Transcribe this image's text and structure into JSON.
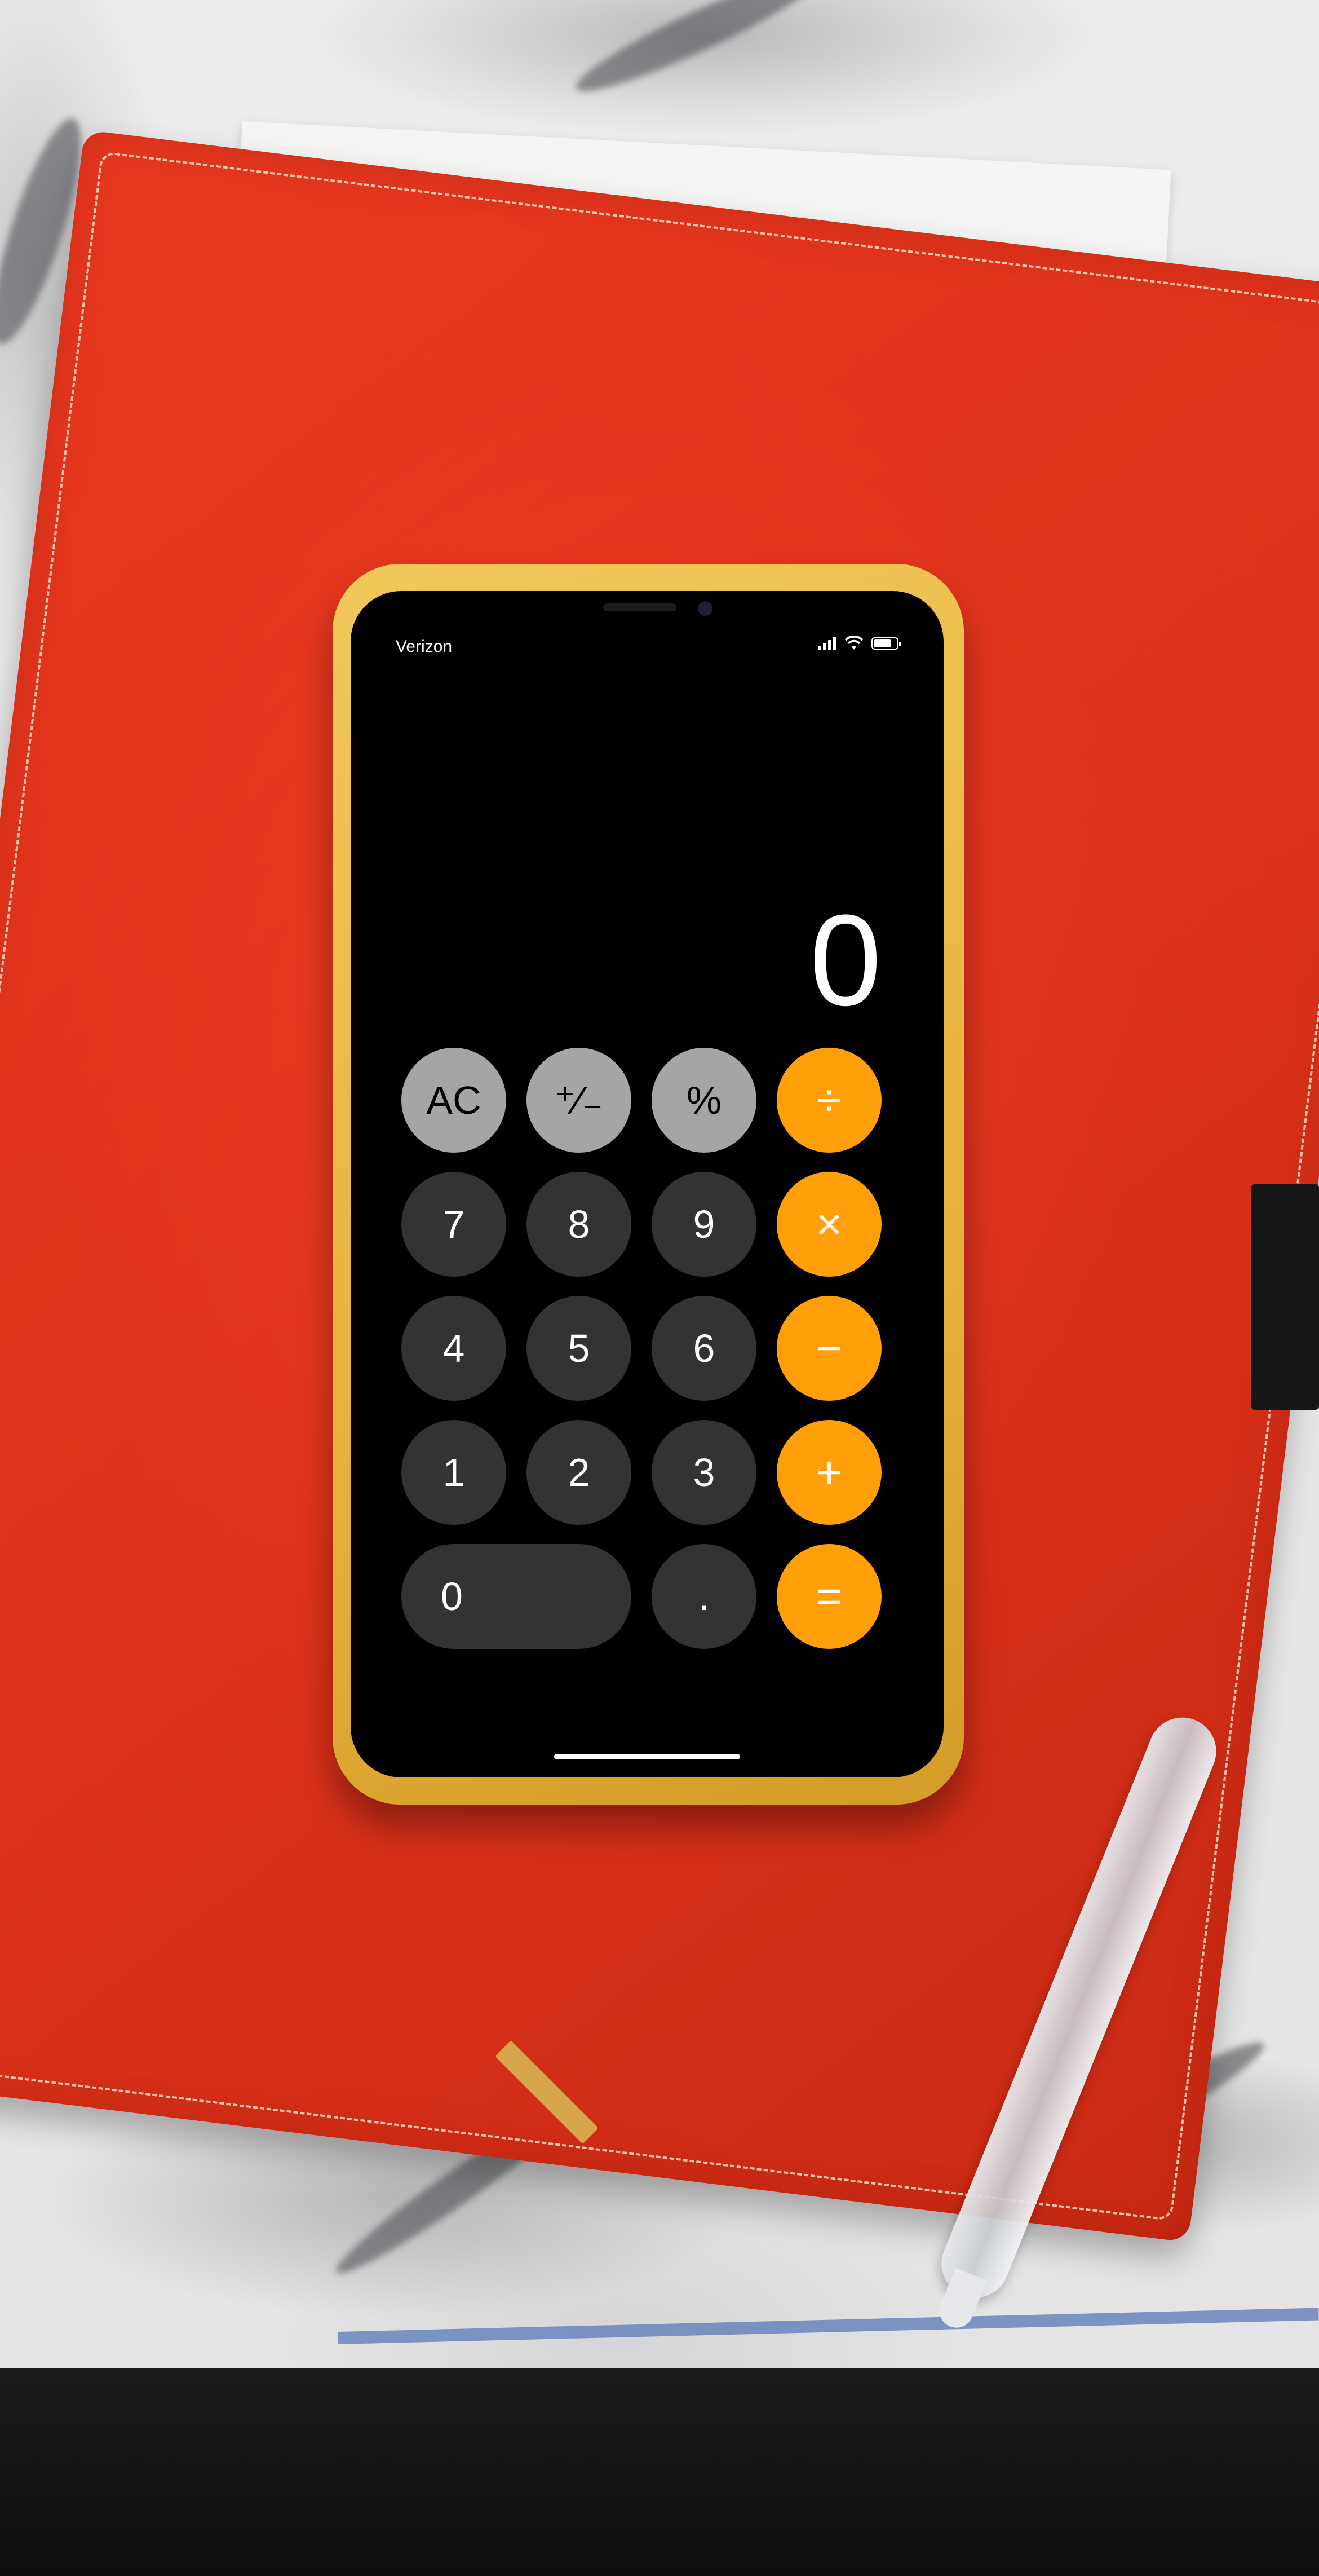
{
  "status_bar": {
    "carrier": "Verizon",
    "battery_level": 0.8
  },
  "calculator": {
    "display": "0",
    "keys": {
      "clear": "AC",
      "sign": "⁺⁄₋",
      "percent": "%",
      "divide": "÷",
      "seven": "7",
      "eight": "8",
      "nine": "9",
      "multiply": "×",
      "four": "4",
      "five": "5",
      "six": "6",
      "subtract": "−",
      "one": "1",
      "two": "2",
      "three": "3",
      "add": "+",
      "zero": "0",
      "decimal": ".",
      "equals": "="
    }
  },
  "colors": {
    "function_key": "#a5a5a5",
    "digit_key": "#333333",
    "operator_key": "#ff9f0a",
    "phone_case": "#e7b23c",
    "notebook": "#e0341c"
  }
}
